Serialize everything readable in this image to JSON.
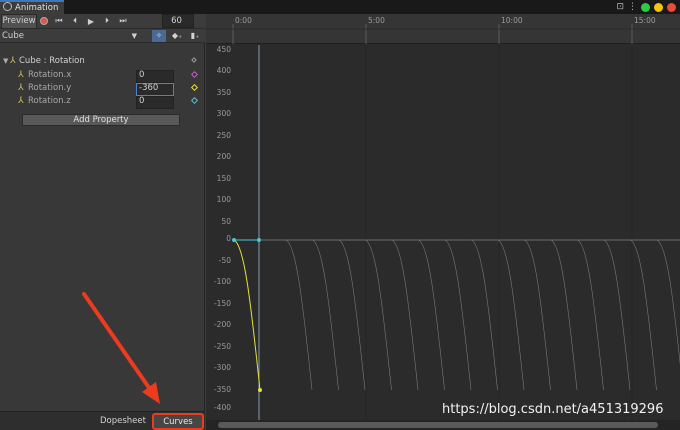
{
  "window": {
    "tab_title": "Animation"
  },
  "toolbar": {
    "preview_label": "Preview",
    "frame_value": "60"
  },
  "clip": {
    "name": "Cube"
  },
  "properties": {
    "group_label": "Cube : Rotation",
    "items": [
      {
        "label": "Rotation.x",
        "value": "0",
        "key_color": "#d64fd6"
      },
      {
        "label": "Rotation.y",
        "value": "-360",
        "key_color": "#e8e03a"
      },
      {
        "label": "Rotation.z",
        "value": "0",
        "key_color": "#43c8d8"
      }
    ],
    "add_button": "Add Property"
  },
  "bottom_tabs": {
    "dopesheet": "Dopesheet",
    "curves": "Curves"
  },
  "timeline": {
    "ticks": [
      "0:00",
      "5:00",
      "10:00",
      "15:00"
    ]
  },
  "yaxis": {
    "labels": [
      "450",
      "400",
      "350",
      "300",
      "250",
      "200",
      "150",
      "100",
      "50",
      "0",
      "-50",
      "-100",
      "-150",
      "-200",
      "-250",
      "-300",
      "-350",
      "-400"
    ]
  },
  "watermark": "https://blog.csdn.net/a451319296",
  "colors": {
    "accent": "#ec3b1f",
    "curve_y": "#e8e03a",
    "curve_z": "#43c8d8"
  }
}
